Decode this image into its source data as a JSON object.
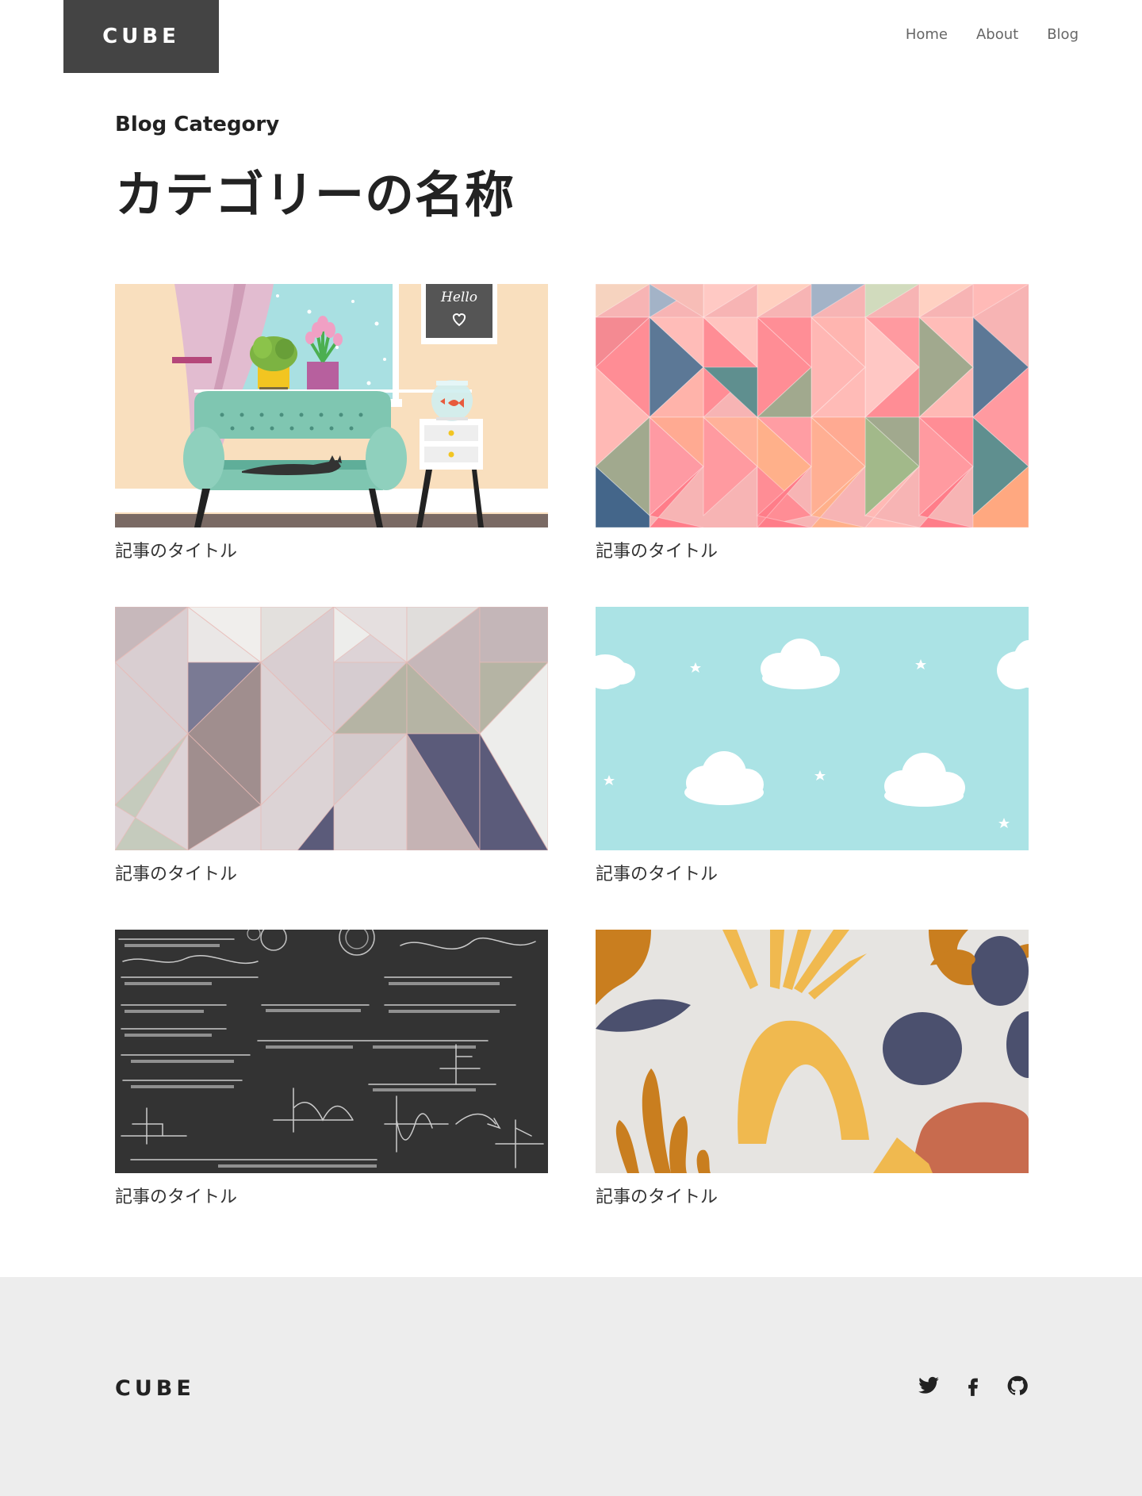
{
  "header": {
    "logo": "CUBE",
    "nav": [
      {
        "label": "Home"
      },
      {
        "label": "About"
      },
      {
        "label": "Blog"
      }
    ]
  },
  "main": {
    "eyebrow": "Blog Category",
    "title": "カテゴリーの名称",
    "posts": [
      {
        "title": "記事のタイトル",
        "thumbnail_sign": "Hello"
      },
      {
        "title": "記事のタイトル"
      },
      {
        "title": "記事のタイトル"
      },
      {
        "title": "記事のタイトル"
      },
      {
        "title": "記事のタイトル"
      },
      {
        "title": "記事のタイトル"
      }
    ]
  },
  "footer": {
    "logo": "CUBE",
    "social": [
      {
        "icon": "twitter-icon"
      },
      {
        "icon": "facebook-icon"
      },
      {
        "icon": "github-icon"
      }
    ]
  },
  "colors": {
    "logo_bg": "#444444",
    "text": "#222222",
    "nav_text": "#666666",
    "footer_bg": "#ededed"
  }
}
